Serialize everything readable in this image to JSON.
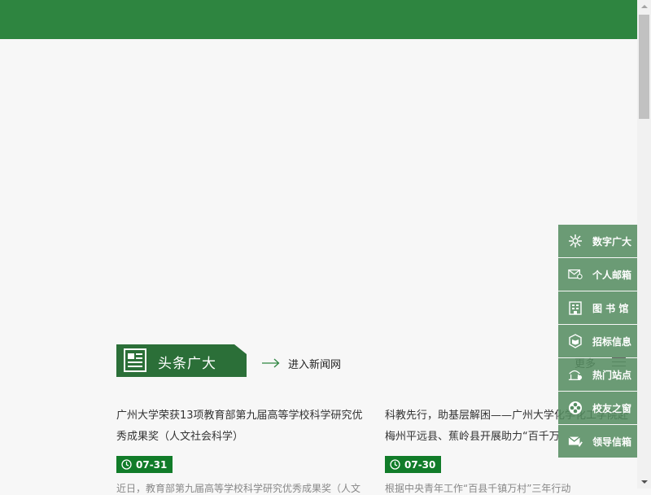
{
  "section": {
    "title": "头条广大",
    "enter_link": "进入新闻网",
    "more": "更多"
  },
  "articles": [
    {
      "headline": "广州大学荣获13项教育部第九届高等学校科学研究优秀成果奖（人文社会科学）",
      "date": "07-31",
      "excerpt": "近日，教育部第九届高等学校科学研究优秀成果奖（人文"
    },
    {
      "headline": "科教先行，助基层解困——广州大学化学化工学院赴梅州平远县、蕉岭县开展助力“百千万",
      "date": "07-30",
      "excerpt": "根据中央青年工作“百县千镇万村”三年行动"
    }
  ],
  "side_nav": [
    {
      "icon": "gear-network-icon",
      "label": "数字广大"
    },
    {
      "icon": "mail-user-icon",
      "label": "个人邮箱"
    },
    {
      "icon": "building-icon",
      "label": "图 书 馆"
    },
    {
      "icon": "shield-book-icon",
      "label": "招标信息"
    },
    {
      "icon": "hot-site-icon",
      "label": "热门站点"
    },
    {
      "icon": "flower-icon",
      "label": "校友之窗"
    },
    {
      "icon": "mail-pen-icon",
      "label": "领导信箱"
    }
  ],
  "colors": {
    "header": "#2e8540",
    "section_head": "#2b6f38",
    "date_badge": "#117c29"
  }
}
